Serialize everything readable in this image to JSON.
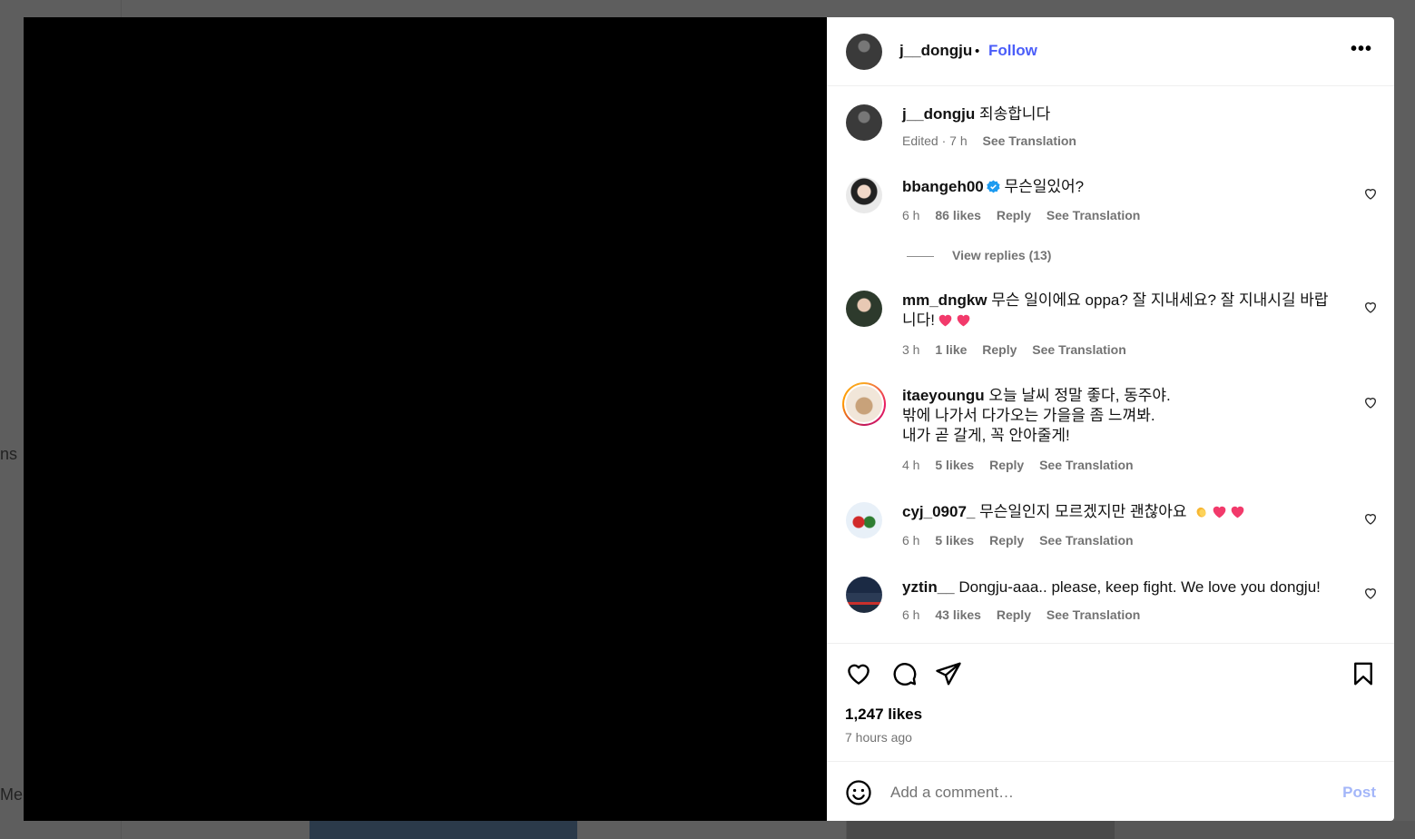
{
  "background": {
    "left_text_1": "ns",
    "left_text_2": "Me"
  },
  "post": {
    "author": "j__dongju",
    "separator": "•",
    "follow_label": "Follow",
    "more_label": "•••",
    "caption_user": "j__dongju",
    "caption_text": "죄송합니다",
    "caption_meta_edited": "Edited · 7 h",
    "caption_meta_translate": "See Translation"
  },
  "comments": [
    {
      "user": "bbangeh00",
      "verified": true,
      "text": "무슨일있어?",
      "time": "6 h",
      "likes": "86 likes",
      "reply": "Reply",
      "translate": "See Translation",
      "view_replies": "View replies (13)"
    },
    {
      "user": "mm_dngkw",
      "text": "무슨 일이에요 oppa? 잘 지내세요? 잘 지내시길 바랍니다!",
      "time": "3 h",
      "likes": "1 like",
      "reply": "Reply",
      "translate": "See Translation"
    },
    {
      "user": "itaeyoungu",
      "text_line1": "오늘 날씨 정말 좋다, 동주야.",
      "text_line2": "밖에 나가서 다가오는 가을을 좀 느껴봐.",
      "text_line3": "내가 곧 갈게, 꼭 안아줄게!",
      "time": "4 h",
      "likes": "5 likes",
      "reply": "Reply",
      "translate": "See Translation"
    },
    {
      "user": "cyj_0907_",
      "text": "무슨일인지 모르겠지만 괜찮아요",
      "time": "6 h",
      "likes": "5 likes",
      "reply": "Reply",
      "translate": "See Translation"
    },
    {
      "user": "yztin__",
      "text": "Dongju-aaa.. please, keep fight. We love you dongju!",
      "time": "6 h",
      "likes": "43 likes",
      "reply": "Reply",
      "translate": "See Translation"
    }
  ],
  "footer": {
    "likes": "1,247 likes",
    "time": "7 hours ago",
    "comment_placeholder": "Add a comment…",
    "post_label": "Post"
  }
}
